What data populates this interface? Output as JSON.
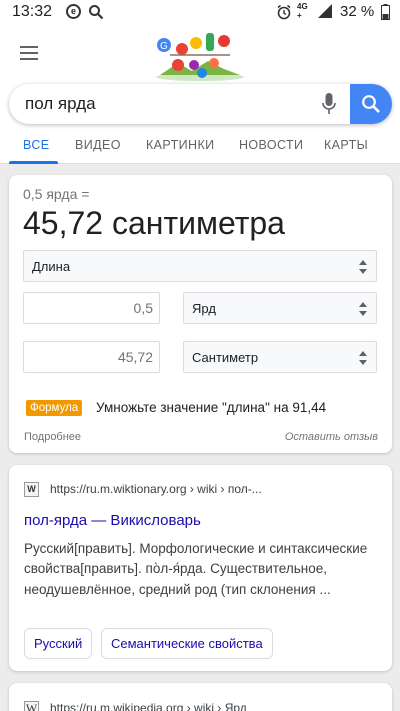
{
  "status_bar": {
    "time": "13:32",
    "e_glyph": "e",
    "network": "4G",
    "network_sub": "+",
    "battery": "32 %",
    "icons": [
      "e-circle-icon",
      "search-icon",
      "alarm-icon",
      "signal-icon",
      "battery-icon"
    ]
  },
  "header": {
    "menu_icon": "hamburger-icon",
    "doodle_icon": "google-doodle-icon",
    "search": {
      "query": "пол ярда",
      "mic_icon": "mic-icon",
      "search_icon": "search-icon"
    },
    "tabs": [
      {
        "label": "ВСЕ",
        "active": true
      },
      {
        "label": "ВИДЕО"
      },
      {
        "label": "КАРТИНКИ"
      },
      {
        "label": "НОВОСТИ"
      },
      {
        "label": "КАРТЫ"
      }
    ]
  },
  "converter": {
    "input_line": "0,5 ярда =",
    "result": "45,72 сантиметра",
    "category": "Длина",
    "from_value": "0,5",
    "from_unit": "Ярд",
    "to_value": "45,72",
    "to_unit": "Сантиметр",
    "formula_badge": "Формула",
    "formula_text": "Умножьте значение \"длина\" на 91,44",
    "more_link": "Подробнее",
    "feedback_link": "Оставить отзыв"
  },
  "results": [
    {
      "favicon": "W",
      "url": "https://ru.m.wiktionary.org › wiki › пол-...",
      "title": "пол-ярда — Викисловарь",
      "snippet": "Русский[править]. Морфологические и синтаксические свойства[править]. по̀л-я́рда. Существительное, неодушевлённое, средний род (тип склонения ...",
      "chips": [
        "Русский",
        "Семантические свойства"
      ]
    },
    {
      "favicon": "W",
      "url": "https://ru.m.wikipedia.org › wiki › Ярд"
    }
  ],
  "colors": {
    "accent": "#1a73e8",
    "link": "#1a0dab",
    "formula": "#f29900",
    "search_btn": "#4285f4"
  }
}
